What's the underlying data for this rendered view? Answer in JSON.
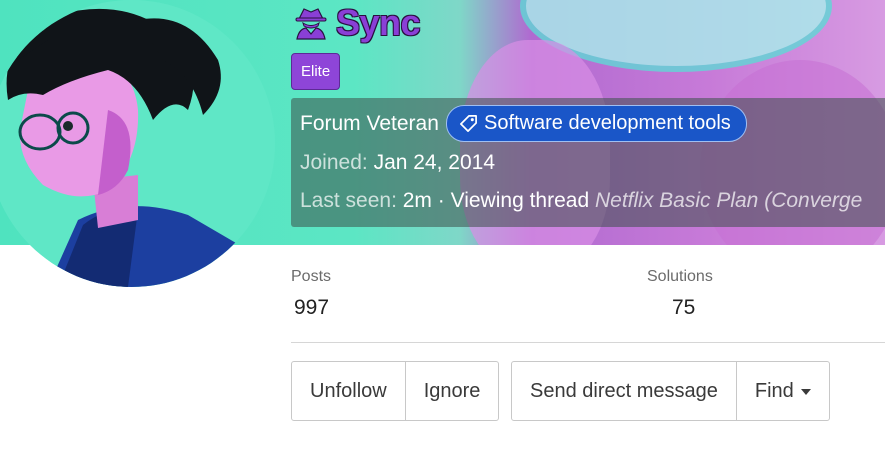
{
  "profile": {
    "username": "Sync",
    "user_icon": "spy-icon",
    "banner_label": "Elite",
    "title": "Forum Veteran",
    "tag": {
      "icon": "tag-icon",
      "label": "Software development tools"
    },
    "joined_label": "Joined:",
    "joined_value": "Jan 24, 2014",
    "last_seen_label": "Last seen:",
    "last_seen_value": "2m · Viewing thread",
    "last_seen_thread": "Netflix Basic Plan (Converge"
  },
  "stats": {
    "posts_label": "Posts",
    "posts_value": "997",
    "solutions_label": "Solutions",
    "solutions_value": "75"
  },
  "actions": {
    "unfollow": "Unfollow",
    "ignore": "Ignore",
    "send_message": "Send direct message",
    "find": "Find"
  },
  "colors": {
    "username": "#8a3fd6",
    "badge": "#8e45d8",
    "tag": "#1a56c8"
  }
}
